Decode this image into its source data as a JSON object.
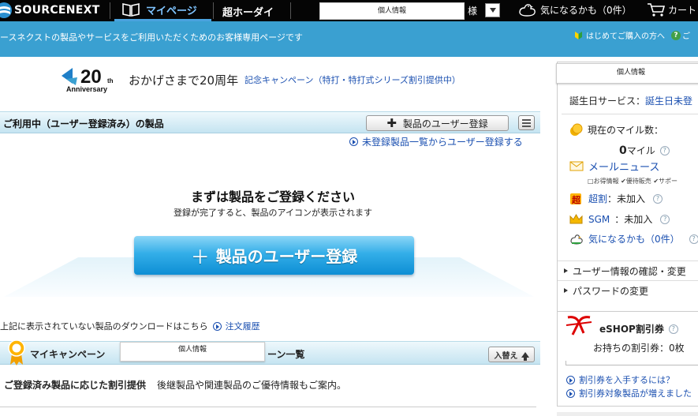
{
  "header": {
    "logo_text": "SOURCENEXT",
    "nav_mypage": "マイページ",
    "nav_cho_hoday": "超ホーダイ",
    "user_name_placeholder": "個人情報",
    "honorific": "様",
    "favorites": "気になるかも（0件）",
    "cart": "カート"
  },
  "banner": {
    "text": "ースネクストの製品やサービスをご利用いただくためのお客様専用ページです",
    "beginner": "はじめてご購入の方へ",
    "beginner_suffix": "ご"
  },
  "anniversary": {
    "number": "20",
    "suffix": "th",
    "word": "Anniversary",
    "text": "おかげさまで20周年",
    "link": "記念キャンペーン（特打・特打式シリーズ割引提供中）"
  },
  "products": {
    "title": "ご利用中（ユーザー登録済み）の製品",
    "register_button": "製品のユーザー登録",
    "unregistered_link": "未登録製品一覧からユーザー登録する",
    "empty_title": "まずは製品をご登録ください",
    "empty_sub": "登録が完了すると、製品のアイコンが表示されます",
    "big_register_button": "製品のユーザー登録",
    "download_text": "上記に表示されていない製品のダウンロードはこちら",
    "order_history": "注文履歴"
  },
  "campaign": {
    "title_a": "マイキャンペーン",
    "name_placeholder": "個人情報",
    "title_b": "ーン一覧",
    "sort_button": "入替え",
    "offer_bold": "ご登録済み製品に応じた割引提供",
    "offer_text": "後継製品や関連製品のご優待情報もご案内。"
  },
  "sidebar": {
    "name_placeholder": "個人情報",
    "birthday_label": "誕生日サービス：",
    "birthday_link": "誕生日未登",
    "miles_label": "現在のマイル数：",
    "miles_value": "0",
    "miles_unit": "マイル",
    "mail_news": "メールニュース",
    "mail_opts": "□お得情報 ✔優待販売 ✔サポー",
    "chowari": "超割",
    "chowari_status": "：未加入",
    "sgm": "SGM",
    "sgm_status": "：未加入",
    "favorites": "気になるかも（0件）",
    "nav_user_info": "ユーザー情報の確認・変更",
    "nav_password": "パスワードの変更",
    "eshop_title": "eSHOP割引券",
    "eshop_count": "お持ちの割引券：0枚",
    "eshop_link1": "割引券を入手するには？",
    "eshop_link2": "割引券対象製品が増えました"
  },
  "colors": {
    "banner": "#3aa0d1",
    "topbar": "#050505",
    "link": "#1a4fb0",
    "section_header": "#c5e4f1"
  }
}
